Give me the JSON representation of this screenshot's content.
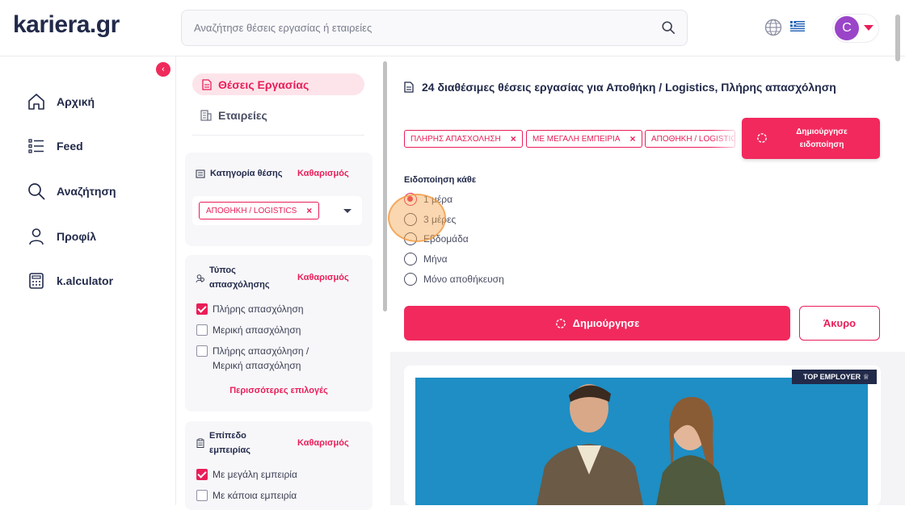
{
  "header": {
    "logo": "kariera.gr",
    "search_placeholder": "Αναζήτησε θέσεις εργασίας ή εταιρείες",
    "avatar_letter": "C"
  },
  "sidebar": {
    "items": [
      {
        "label": "Αρχική",
        "icon": "home-icon"
      },
      {
        "label": "Feed",
        "icon": "feed-icon"
      },
      {
        "label": "Αναζήτηση",
        "icon": "search-icon"
      },
      {
        "label": "Προφίλ",
        "icon": "profile-icon"
      },
      {
        "label": "k.alculator",
        "icon": "calculator-icon"
      }
    ]
  },
  "filters": {
    "tab_jobs": "Θέσεις Εργασίας",
    "tab_companies": "Εταιρείες",
    "category": {
      "title": "Κατηγορία θέσης",
      "clear": "Καθαρισμός",
      "chip": "ΑΠΟΘΗΚΗ / LOGISTICS"
    },
    "employment": {
      "title_line1": "Τύπος",
      "title_line2": "απασχόλησης",
      "clear": "Καθαρισμός",
      "options": [
        {
          "label": "Πλήρης απασχόληση",
          "checked": true
        },
        {
          "label": "Μερική απασχόληση",
          "checked": false
        },
        {
          "label": "Πλήρης απασχόληση / Μερική απασχόληση",
          "checked": false
        }
      ],
      "more": "Περισσότερες επιλογές"
    },
    "experience": {
      "title_line1": "Επίπεδο",
      "title_line2": "εμπειρίας",
      "clear": "Καθαρισμός",
      "options": [
        {
          "label": "Με μεγάλη εμπειρία",
          "checked": true
        },
        {
          "label": "Με κάποια εμπειρία",
          "checked": false
        }
      ]
    }
  },
  "main": {
    "title": "24 διαθέσιμες θέσεις εργασίας για Αποθήκη / Logistics, Πλήρης απασχόληση",
    "active_filters": [
      "ΠΛΗΡΗΣ ΑΠΑΣΧΟΛΗΣΗ",
      "ΜΕ ΜΕΓΑΛΗ ΕΜΠΕΙΡΙΑ",
      "ΑΠΟΘΗΚΗ / LOGISTICS"
    ],
    "alert_button_line1": "Δημιούργησε",
    "alert_button_line2": "ειδοποίηση",
    "notify_label": "Ειδοποίηση κάθε",
    "frequency_options": [
      {
        "label": "1 μέρα",
        "selected": true
      },
      {
        "label": "3 μέρες",
        "selected": false
      },
      {
        "label": "Εβδομάδα",
        "selected": false
      },
      {
        "label": "Μήνα",
        "selected": false
      },
      {
        "label": "Μόνο αποθήκευση",
        "selected": false
      }
    ],
    "create_button": "Δημιούργησε",
    "cancel_button": "Άκυρο",
    "top_employer_badge": "TOP EMPLOYER"
  },
  "colors": {
    "accent": "#e91e58",
    "navy": "#222a4a"
  }
}
